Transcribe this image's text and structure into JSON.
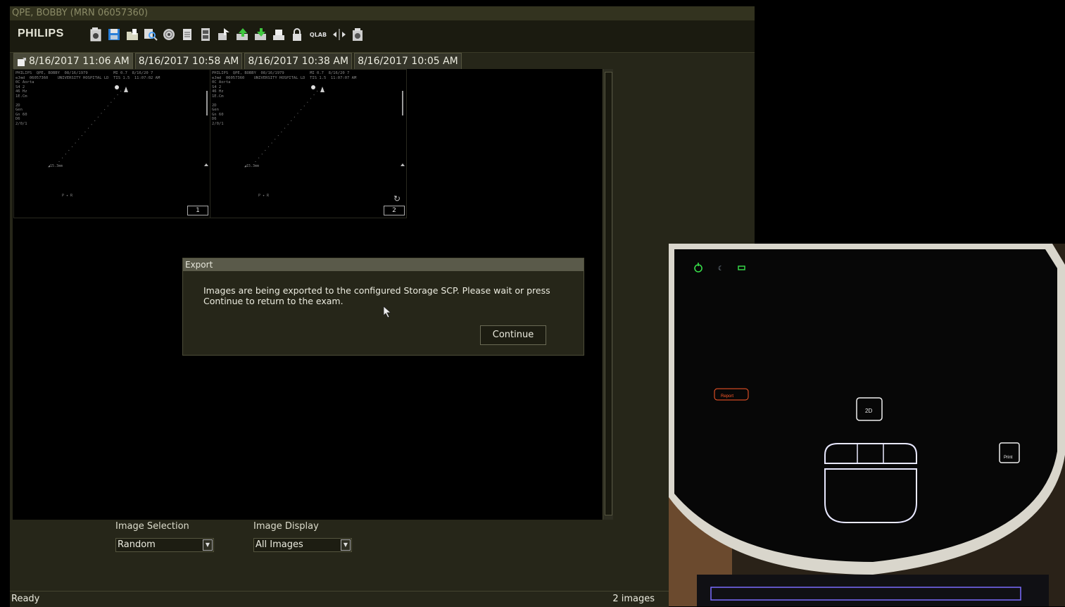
{
  "window": {
    "title": "QPE, BOBBY  (MRN 06057360)"
  },
  "toolbar": {
    "logo": "PHILIPS",
    "icons": [
      "new-exam-icon",
      "save-icon",
      "open-folder-icon",
      "search-icon",
      "disc-icon",
      "document-icon",
      "archive-icon",
      "export-icon",
      "upload-icon",
      "download-icon",
      "print-icon",
      "lock-icon",
      "qlab-icon",
      "split-icon",
      "camera-icon"
    ],
    "qlab_label": "QLAB"
  },
  "tabs": [
    {
      "label": "8/16/2017 11:06 AM",
      "active": true
    },
    {
      "label": "8/16/2017 10:58 AM",
      "active": false
    },
    {
      "label": "8/16/2017 10:38 AM",
      "active": false
    },
    {
      "label": "8/16/2017 10:05 AM",
      "active": false
    }
  ],
  "thumbnails": [
    {
      "index": "1",
      "header": "PHILIPS  QPE, BOBBY  08/16/1979           MI 0.7  8/16/20 7\neJmd  06057360    UNIVERSITY HOSPITAL LD  TIS 1.5  11:07:02 AM\n0C Aorta\nS4 2\n46 Hz\n1E.Cm\n\n2D\nGen\nGn 60\nD6\n2/0/1"
    },
    {
      "index": "2",
      "header": "PHILIPS  QPE, BOBBY  08/16/1979           MI 0.7  8/16/20 7\neJmd  06057360    UNIVERSITY HOSPITAL LD  TIS 1.5  11:07:07 AM\n0C Aorta\nS4 2\n46 Hz\n1E.Cm\n\n2D\nGen\nGn 60\nD6\n2/0/1"
    }
  ],
  "dialog": {
    "title": "Export",
    "message": "Images are being exported to the configured Storage SCP. Please wait or press Continue to return to the exam.",
    "button": "Continue"
  },
  "controls": {
    "image_selection": {
      "label": "Image Selection",
      "value": "Random"
    },
    "image_display": {
      "label": "Image Display",
      "value": "All Images"
    }
  },
  "status": {
    "left": "Ready",
    "right": "2 images"
  },
  "photo": {
    "report_label": "Report",
    "mode_label": "2D",
    "print_label": "Print",
    "colors": {
      "power": "#38e04a",
      "report": "#ff5a2a",
      "trackpad": "#e8e8ff",
      "accent": "#7a6cff"
    }
  }
}
